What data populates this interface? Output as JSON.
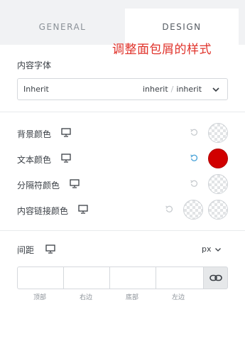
{
  "tabs": {
    "general": "GENERAL",
    "design": "DESIGN"
  },
  "annotation": "调整面包屑的样式",
  "content_font": {
    "label": "内容字体",
    "value": "Inherit",
    "weight": "inherit",
    "style": "inherit",
    "separator": "/"
  },
  "colors": {
    "background": {
      "label": "背景颜色"
    },
    "text": {
      "label": "文本颜色",
      "value": "#d10000"
    },
    "separator": {
      "label": "分隔符颜色"
    },
    "link": {
      "label": "内容链接颜色"
    }
  },
  "spacing": {
    "label": "间距",
    "unit": "px",
    "captions": [
      "顶部",
      "右边",
      "底部",
      "左边"
    ]
  },
  "icons": {
    "device": "monitor-icon",
    "reset": "reset-icon",
    "link": "link-icon",
    "dropdown": "chevron-down-icon"
  },
  "accent_reset_color": "#4aa3d8"
}
